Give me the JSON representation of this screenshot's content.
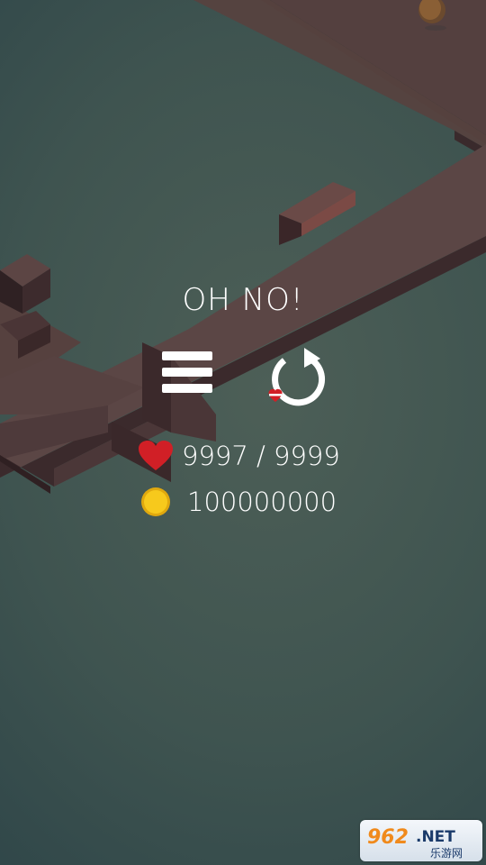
{
  "screen": {
    "title": "OH NO!"
  },
  "buttons": {
    "menu": "menu-icon",
    "retry": "retry-icon"
  },
  "stats": {
    "lives": "9997 / 9999",
    "coins": "100000000"
  },
  "watermark": {
    "text": "962.NET",
    "subtext": "乐游网"
  },
  "colors": {
    "background": "#3f5450",
    "platform_top": "#5a4646",
    "platform_side": "#3a2a2c",
    "heart": "#d11f26",
    "coin": "#f5c518",
    "text": "#ffffff"
  }
}
